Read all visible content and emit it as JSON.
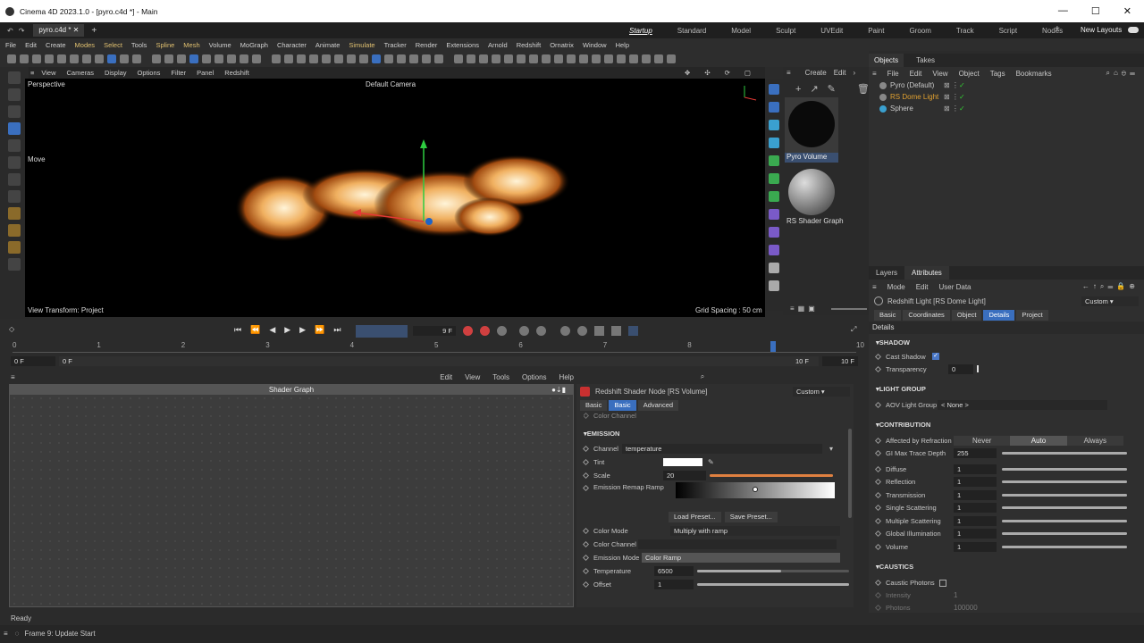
{
  "title_bar": {
    "title": "Cinema 4D 2023.1.0 - [pyro.c4d *] - Main"
  },
  "doc_tab": {
    "label": "pyro.c4d *"
  },
  "layouts": {
    "items": [
      "Startup",
      "Standard",
      "Model",
      "Sculpt",
      "UVEdit",
      "Paint",
      "Groom",
      "Track",
      "Script",
      "Nodes"
    ],
    "active": "Startup",
    "new_layouts": "New Layouts"
  },
  "menu": {
    "items": [
      "File",
      "Edit",
      "Create",
      "Modes",
      "Select",
      "Tools",
      "Spline",
      "Mesh",
      "Volume",
      "MoGraph",
      "Character",
      "Animate",
      "Simulate",
      "Tracker",
      "Render",
      "Extensions",
      "Arnold",
      "Redshift",
      "Ornatrix",
      "Window",
      "Help"
    ]
  },
  "viewport_menu": {
    "items": [
      "View",
      "Cameras",
      "Display",
      "Options",
      "Filter",
      "Panel",
      "Redshift"
    ]
  },
  "viewport": {
    "name": "Perspective",
    "camera": "Default Camera",
    "tool": "Move",
    "view_transform": "View Transform: Project",
    "grid": "Grid Spacing : 50 cm"
  },
  "materials": {
    "menu": [
      "Create",
      "Edit"
    ],
    "items": [
      {
        "name": "Pyro Volume"
      },
      {
        "name": "RS Shader Graph"
      }
    ]
  },
  "objects_panel": {
    "tabs": [
      "Objects",
      "Takes"
    ],
    "menu": [
      "File",
      "Edit",
      "View",
      "Object",
      "Tags",
      "Bookmarks"
    ],
    "items": [
      {
        "name": "Pyro (Default)",
        "color": "#c8c8c8"
      },
      {
        "name": "RS Dome Light",
        "color": "#e0a030"
      },
      {
        "name": "Sphere",
        "color": "#c8c8c8"
      }
    ]
  },
  "attr_panel": {
    "tabs": [
      "Layers",
      "Attributes"
    ],
    "menu": [
      "Mode",
      "Edit",
      "User Data"
    ],
    "object": "Redshift Light [RS Dome Light]",
    "preset": "Custom",
    "subtabs": [
      "Basic",
      "Coordinates",
      "Object",
      "Details",
      "Project"
    ],
    "active_subtab": "Details",
    "section": "Details",
    "shadow": {
      "title": "SHADOW",
      "cast_shadow": "Cast Shadow",
      "transparency_label": "Transparency",
      "transparency": "0"
    },
    "light_group": {
      "title": "LIGHT GROUP",
      "label": "AOV Light Group",
      "value": "< None >"
    },
    "contribution": {
      "title": "CONTRIBUTION",
      "refraction_label": "Affected by Refraction",
      "refraction_opts": [
        "Never",
        "Auto",
        "Always"
      ],
      "gi_label": "GI Max Trace Depth",
      "gi_value": "255",
      "rows": [
        {
          "label": "Diffuse",
          "value": "1"
        },
        {
          "label": "Reflection",
          "value": "1"
        },
        {
          "label": "Transmission",
          "value": "1"
        },
        {
          "label": "Single Scattering",
          "value": "1"
        },
        {
          "label": "Multiple Scattering",
          "value": "1"
        },
        {
          "label": "Global Illumination",
          "value": "1"
        },
        {
          "label": "Volume",
          "value": "1"
        }
      ]
    },
    "caustics": {
      "title": "CAUSTICS",
      "photons_label": "Caustic Photons",
      "intensity_label": "Intensity",
      "intensity": "1",
      "count_label": "Photons",
      "count": "100000"
    }
  },
  "timeline": {
    "ticks": [
      "0",
      "1",
      "2",
      "3",
      "4",
      "5",
      "6",
      "7",
      "8",
      "9",
      "10"
    ],
    "frame": "9 F",
    "start": "0 F",
    "start2": "0 F",
    "end": "10 F",
    "end2": "10 F"
  },
  "shader_graph": {
    "menu": [
      "Edit",
      "View",
      "Tools",
      "Options",
      "Help"
    ],
    "title": "Shader Graph"
  },
  "node_panel": {
    "title": "Redshift Shader Node [RS Volume]",
    "preset": "Custom",
    "tabs": [
      "Basic",
      "Basic",
      "Advanced"
    ],
    "color_channel_top": "Color Channel",
    "emission": {
      "title": "EMISSION",
      "channel_label": "Channel",
      "channel": "temperature",
      "tint_label": "Tint",
      "scale_label": "Scale",
      "scale": "20",
      "ramp_label": "Emission Remap Ramp",
      "load": "Load Preset...",
      "save": "Save Preset...",
      "color_mode_label": "Color Mode",
      "color_mode": "Multiply with ramp",
      "color_channel_label": "Color Channel",
      "emission_mode_label": "Emission Mode",
      "emission_mode": "Color Ramp",
      "temperature_label": "Temperature",
      "temperature": "6500",
      "offset_label": "Offset",
      "offset": "1"
    }
  },
  "status": {
    "ready": "Ready",
    "frame": "Frame 9: Update Start"
  }
}
